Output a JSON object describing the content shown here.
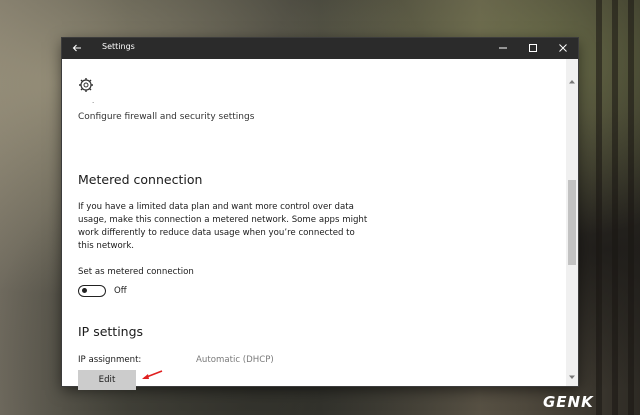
{
  "window": {
    "title": "Settings",
    "controls": [
      "minimize",
      "maximize",
      "close"
    ]
  },
  "top": {
    "icon": "gear-icon",
    "dot": "·",
    "firewall_link": "Configure firewall and security settings"
  },
  "metered": {
    "heading": "Metered connection",
    "description": "If you have a limited data plan and want more control over data usage, make this connection a metered network. Some apps might work differently to reduce data usage when you’re connected to this network.",
    "toggle_label": "Set as metered connection",
    "toggle_state": "Off"
  },
  "ip": {
    "heading": "IP settings",
    "assignment_label": "IP assignment:",
    "assignment_value": "Automatic (DHCP)",
    "edit_label": "Edit"
  },
  "watermark": "GENK",
  "colors": {
    "titlebar": "#2b2b2b",
    "edit_button": "#cccccc",
    "arrow": "#e02020"
  }
}
